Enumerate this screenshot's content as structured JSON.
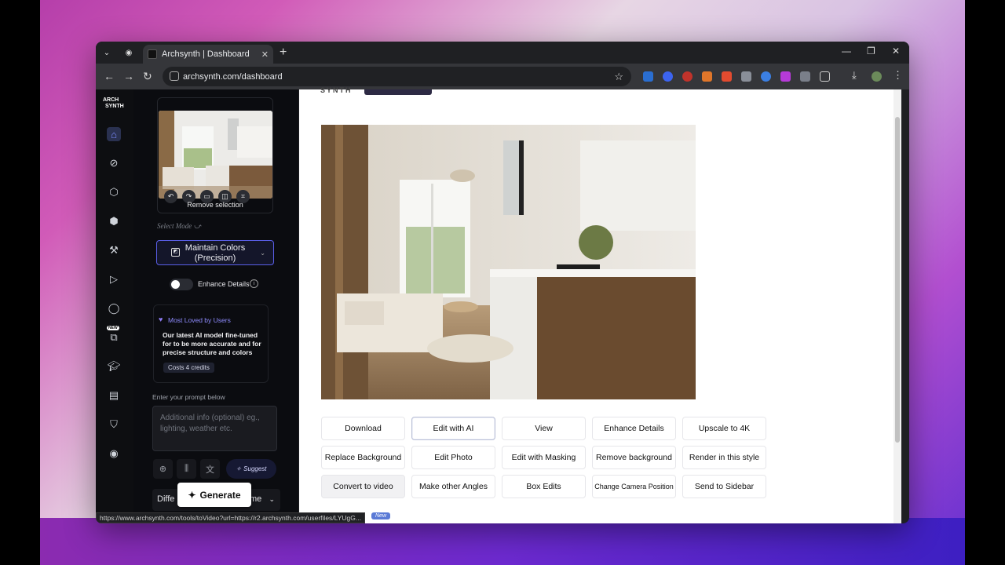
{
  "browser": {
    "tab_title": "Archsynth | Dashboard",
    "url": "archsynth.com/dashboard",
    "status_url": "https://www.archsynth.com/tools/toVideo?url=https://r2.archsynth.com/userfiles/LYUgG..."
  },
  "rail": {
    "logo_line1": "ARCH",
    "logo_line2": "SYNTH",
    "new_badge": "NEW"
  },
  "sidebar": {
    "remove_selection": "Remove selection",
    "select_mode": "Select Mode",
    "mode_button": "Maintain Colors (Precision)",
    "enhance_details": "Enhance Details",
    "loved_heading": "Most Loved by Users",
    "loved_body": "Our latest AI model fine-tuned for to be more accurate and for precise structure and colors",
    "loved_cost": "Costs 4 credits",
    "prompt_label": "Enter your prompt below",
    "prompt_placeholder": "Additional info (optional) eg., lighting, weather etc.",
    "suggest": "Suggest",
    "diff_row_left": "Diffe",
    "diff_row_right": "me",
    "generate": "Generate"
  },
  "main": {
    "top_fragment": "SYNTH",
    "actions": [
      [
        "Download",
        "Edit with AI",
        "View",
        "Enhance Details",
        "Upscale to 4K"
      ],
      [
        "Replace Background",
        "Edit Photo",
        "Edit with Masking",
        "Remove background",
        "Render in this style"
      ],
      [
        "Convert to video",
        "Make other Angles",
        "Box Edits",
        "Change Camera Position",
        "Send to Sidebar"
      ]
    ],
    "new_tag": "New"
  }
}
